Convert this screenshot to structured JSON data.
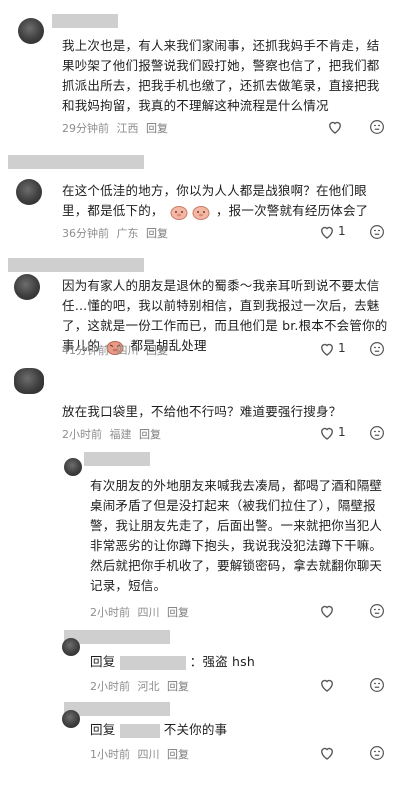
{
  "comments": [
    {
      "text": "我上次也是，有人来我们家闹事，还抓我妈手不肯走，结果吵架了他们报警说我们殴打她，警察也信了，把我们都抓派出所去，把我手机也缴了，还抓去做笔录，直接把我和我妈拘留，我真的不理解这种流程是什么情况",
      "time": "29分钟前",
      "location": "江西",
      "reply": "回复"
    },
    {
      "text_a": "在这个低洼的地方，你以为人人都是战狼啊？在他们眼里，都是低下的，",
      "text_b": "，报一次警就有经历体会了",
      "time": "36分钟前",
      "location": "广东",
      "reply": "回复",
      "likes": "1"
    },
    {
      "text_a": "因为有家人的朋友是退休的蜀黍～我亲耳听到说不要太信任…懂的吧，我以前特别相信，直到我报过一次后，去魅了，这就是一份工作而已，而且他们是 br.根本不会管你的事儿的",
      "text_b": "都是胡乱处理",
      "time": "41分钟前",
      "location": "四川",
      "reply": "回复",
      "likes": "1"
    },
    {
      "text": "放在我口袋里，不给他不行吗？难道要强行搜身？",
      "time": "2小时前",
      "location": "福建",
      "reply": "回复",
      "likes": "1"
    },
    {
      "text": "有次朋友的外地朋友来喊我去凑局，都喝了酒和隔壁桌闹矛盾了但是没打起来（被我们拉住了），隔壁报警，我让朋友先走了，后面出警。一来就把你当犯人非常恶劣的让你蹲下抱头，我说我没犯法蹲下干嘛。然后就把你手机收了，要解锁密码，拿去就翻你聊天记录，短信。",
      "time": "2小时前",
      "location": "四川",
      "reply": "回复"
    },
    {
      "reply_prefix": "回复",
      "text": "：强盗 hsh",
      "time": "2小时前",
      "location": "河北",
      "reply": "回复"
    },
    {
      "reply_prefix": "回复",
      "text": "不关你的事",
      "time": "1小时前",
      "location": "四川",
      "reply": "回复"
    }
  ],
  "icons": {
    "reply_glyph": "▭",
    "like_icon": "heart-icon",
    "dislike_icon": "dislike-face-icon"
  }
}
